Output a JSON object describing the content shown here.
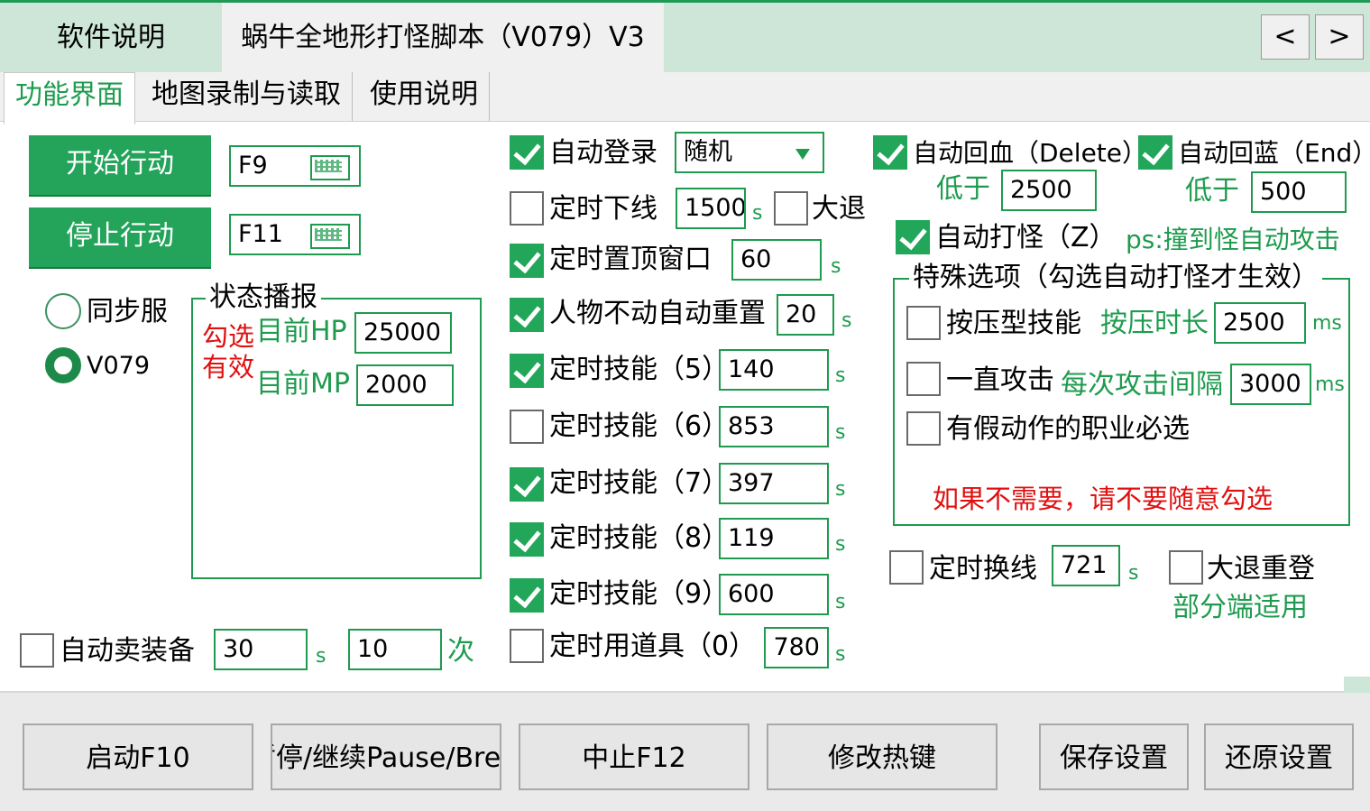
{
  "tabs": {
    "t1": "软件说明",
    "t2": "蜗牛全地形打怪脚本（V079）V3",
    "prev": "<",
    "next": ">"
  },
  "subtabs": {
    "s1": "功能界面",
    "s2": "地图录制与读取",
    "s3": "使用说明"
  },
  "left": {
    "start": "开始行动",
    "start_key": "F9",
    "stop": "停止行动",
    "stop_key": "F11",
    "server_sync": "同步服",
    "server_v079": "V079",
    "status_title": "状态播报",
    "valid_note": "勾选有效",
    "hp_label": "目前HP",
    "hp": "25000",
    "mp_label": "目前MP",
    "mp": "2000",
    "sell_label": "自动卖装备",
    "sell_s": "30",
    "sell_times": "10",
    "times_unit": "次"
  },
  "mid": {
    "auto_login": "自动登录",
    "login_mode": "随机",
    "timed_offline": "定时下线",
    "offline_s": "1500",
    "big_exit": "大退",
    "top_window": "定时置顶窗口",
    "top_s": "60",
    "idle_reset": "人物不动自动重置",
    "idle_s": "20",
    "skill5": "定时技能（5）",
    "skill5_v": "140",
    "skill6": "定时技能（6）",
    "skill6_v": "853",
    "skill7": "定时技能（7）",
    "skill7_v": "397",
    "skill8": "定时技能（8）",
    "skill8_v": "119",
    "skill9": "定时技能（9）",
    "skill9_v": "600",
    "item0": "定时用道具（0）",
    "item0_v": "780",
    "s_unit": "s"
  },
  "right": {
    "auto_hp": "自动回血（Delete）",
    "auto_mp": "自动回蓝（End）",
    "below": "低于",
    "hp_thr": "2500",
    "mp_thr": "500",
    "auto_fight": "自动打怪（Z）",
    "ps": "ps:撞到怪自动攻击",
    "special_title": "特殊选项（勾选自动打怪才生效）",
    "press_skill": "按压型技能",
    "press_dur_label": "按压时长",
    "press_dur": "2500",
    "ms": "ms",
    "always_attack": "一直攻击",
    "interval_label": "每次攻击间隔",
    "interval": "3000",
    "fake_action": "有假动作的职业必选",
    "warn": "如果不需要，请不要随意勾选",
    "timed_switch": "定时换线",
    "switch_s": "721",
    "big_relogin": "大退重登",
    "partial": "部分端适用"
  },
  "buttons": {
    "b1": "启动F10",
    "b2": "暂停/继续Pause/Break",
    "b3": "中止F12",
    "b4": "修改热键",
    "b5": "保存设置",
    "b6": "还原设置"
  },
  "colors": {
    "accent": "#1e9b4e",
    "tab_bg": "#cde6d7",
    "warn": "#e01010"
  },
  "states": {
    "auto_login": true,
    "timed_offline": false,
    "big_exit": false,
    "top_window": true,
    "idle_reset": true,
    "skill5": true,
    "skill6": false,
    "skill7": true,
    "skill8": true,
    "skill9": true,
    "item0": false,
    "auto_hp": true,
    "auto_mp": true,
    "auto_fight": true,
    "press_skill": false,
    "always_attack": false,
    "fake_action": false,
    "timed_switch": false,
    "big_relogin": false,
    "sell": false,
    "server": "V079"
  }
}
